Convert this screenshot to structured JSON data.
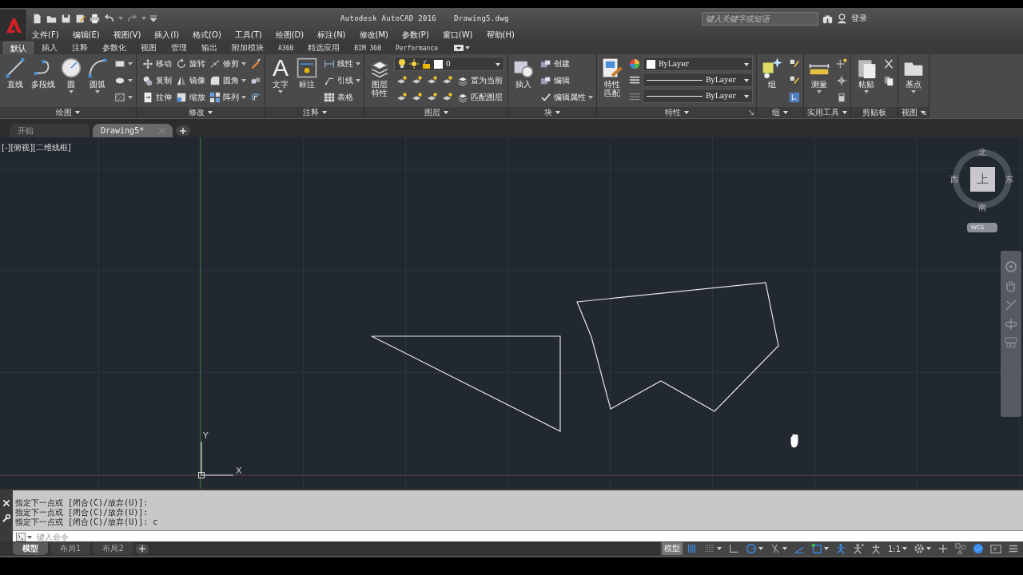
{
  "title_bar": {
    "product": "Autodesk AutoCAD 2016",
    "document": "Drawing5.dwg",
    "search": {
      "placeholder": "键入关键字或短语"
    },
    "sign_in": "登录"
  },
  "menu_bar": [
    "文件(F)",
    "编辑(E)",
    "视图(V)",
    "插入(I)",
    "格式(O)",
    "工具(T)",
    "绘图(D)",
    "标注(N)",
    "修改(M)",
    "参数(P)",
    "窗口(W)",
    "帮助(H)"
  ],
  "ribbon_tabs": [
    {
      "label": "默认",
      "selected": true
    },
    {
      "label": "插入",
      "selected": false
    },
    {
      "label": "注释",
      "selected": false
    },
    {
      "label": "参数化",
      "selected": false
    },
    {
      "label": "视图",
      "selected": false
    },
    {
      "label": "管理",
      "selected": false
    },
    {
      "label": "输出",
      "selected": false
    },
    {
      "label": "附加模块",
      "selected": false
    },
    {
      "label": "A360",
      "selected": false
    },
    {
      "label": "精选应用",
      "selected": false
    },
    {
      "label": "BIM 360",
      "selected": false
    },
    {
      "label": "Performance",
      "selected": false
    }
  ],
  "ribbon_panels": [
    {
      "kind": "inline",
      "title": "绘图",
      "menu": true,
      "launcher": false,
      "large": [
        {
          "kind": "line",
          "label": "直线",
          "dropdown": false
        },
        {
          "kind": "polyline",
          "label": "多段线",
          "dropdown": false
        },
        {
          "kind": "circle",
          "label": "圆",
          "dropdown": true
        },
        {
          "kind": "arc",
          "label": "圆弧",
          "dropdown": true
        }
      ],
      "columns": [
        [
          {
            "kind": "rectangle",
            "dropdown": true
          },
          {
            "kind": "ellipse",
            "dropdown": true
          },
          {
            "kind": "hatch",
            "dropdown": true
          }
        ]
      ]
    },
    {
      "kind": "inline",
      "title": "修改",
      "menu": true,
      "launcher": false,
      "columns": [
        [
          {
            "kind": "cross-arrows",
            "label": "移动",
            "dropdown": false
          },
          {
            "kind": "copy-circles",
            "label": "复制",
            "dropdown": false
          },
          {
            "kind": "stretch-page",
            "label": "拉伸",
            "dropdown": false
          }
        ],
        [
          {
            "kind": "circular-arrow",
            "label": "旋转",
            "dropdown": false
          },
          {
            "kind": "mirror-triangles",
            "label": "镜像",
            "dropdown": false
          },
          {
            "kind": "scale-squares",
            "label": "缩放",
            "dropdown": false
          }
        ],
        [
          {
            "kind": "trim-line",
            "label": "修剪",
            "dropdown": true
          },
          {
            "kind": "rounded-corner",
            "label": "圆角",
            "dropdown": true
          },
          {
            "kind": "grid-squares",
            "label": "阵列",
            "dropdown": true
          }
        ],
        [
          {
            "kind": "eraser",
            "dropdown": false
          },
          {
            "kind": "cubes",
            "dropdown": false
          },
          {
            "kind": "offset-shape",
            "dropdown": false
          }
        ]
      ]
    },
    {
      "kind": "inline",
      "title": "注释",
      "menu": true,
      "launcher": false,
      "large": [
        {
          "kind": "letter",
          "glyph": "A",
          "label": "文字",
          "dropdown": true
        },
        {
          "kind": "dimension",
          "label": "标注",
          "dropdown": false
        }
      ],
      "columns": [
        [
          {
            "kind": "linear-dimension",
            "label": "线性",
            "dropdown": true
          },
          {
            "kind": "leader",
            "label": "引线",
            "dropdown": true
          },
          {
            "kind": "table",
            "label": "表格",
            "dropdown": false
          }
        ]
      ]
    },
    {
      "kind": "stacked",
      "title": "图层",
      "menu": true,
      "launcher": false,
      "large": [
        {
          "kind": "layer-stack",
          "label": "图层特性",
          "dropdown": false
        }
      ],
      "combos": [
        {
          "kind": "layer",
          "value": "0"
        }
      ],
      "columns": [
        [
          {
            "kind": "layer-tool",
            "dropdown": false
          },
          {
            "kind": "layer-tool",
            "dropdown": false
          }
        ],
        [
          {
            "kind": "layer-tool",
            "dropdown": false
          },
          {
            "kind": "layer-tool",
            "dropdown": false
          }
        ],
        [
          {
            "kind": "layer-tool",
            "dropdown": false
          },
          {
            "kind": "layer-tool",
            "dropdown": false
          }
        ],
        [
          {
            "kind": "layer-tool",
            "dropdown": false
          },
          {
            "kind": "layer-tool",
            "dropdown": false
          }
        ],
        [
          {
            "kind": "layer-stack",
            "label": "置为当前",
            "dropdown": false
          },
          {
            "kind": "layer-stack",
            "label": "匹配图层",
            "dropdown": false
          }
        ]
      ]
    },
    {
      "kind": "inline",
      "title": "块",
      "menu": true,
      "launcher": false,
      "large": [
        {
          "kind": "block-insert",
          "label": "插入",
          "dropdown": false
        }
      ],
      "columns": [
        [
          {
            "kind": "block-tool",
            "label": "创建",
            "dropdown": false
          },
          {
            "kind": "block-tool",
            "label": "编辑",
            "dropdown": false
          },
          {
            "kind": "attribute-tick",
            "label": "编辑属性",
            "dropdown": true
          }
        ]
      ]
    },
    {
      "kind": "inline",
      "title": "特性",
      "menu": true,
      "launcher": true,
      "large": [
        {
          "kind": "brush-page",
          "label": "特性匹配",
          "dropdown": false
        }
      ],
      "columns": [
        [
          {
            "kind": "color-wheel",
            "dropdown": false
          },
          {
            "kind": "lineweight-lines",
            "dropdown": false
          },
          {
            "kind": "dashed-lines",
            "dropdown": false
          }
        ]
      ],
      "combos": [
        {
          "kind": "color",
          "value": "ByLayer"
        },
        {
          "kind": "linetype",
          "value": "ByLayer"
        },
        {
          "kind": "lineweight",
          "value": "ByLayer"
        }
      ]
    },
    {
      "kind": "inline",
      "title": "组",
      "menu": true,
      "launcher": false,
      "large": [
        {
          "kind": "sparkle-group",
          "label": "组",
          "dropdown": false
        }
      ],
      "columns": [
        [
          {
            "kind": "group-edit",
            "dropdown": false
          },
          {
            "kind": "group-edit",
            "dropdown": false
          },
          {
            "kind": "group-select",
            "dropdown": false
          }
        ]
      ]
    },
    {
      "kind": "inline",
      "title": "实用工具",
      "menu": true,
      "launcher": false,
      "large": [
        {
          "kind": "ruler",
          "label": "测量",
          "dropdown": true
        }
      ],
      "columns": [
        [
          {
            "kind": "point-add",
            "dropdown": false
          },
          {
            "kind": "crosshair",
            "dropdown": false
          },
          {
            "kind": "calculator",
            "dropdown": false
          }
        ]
      ]
    },
    {
      "kind": "inline",
      "title": "剪贴板",
      "menu": false,
      "launcher": false,
      "large": [
        {
          "kind": "clipboard",
          "label": "粘贴",
          "dropdown": true
        }
      ],
      "columns": [
        [
          {
            "kind": "scissors",
            "dropdown": false
          },
          {
            "kind": "copy-sheets",
            "dropdown": false
          }
        ]
      ]
    },
    {
      "kind": "inline",
      "title": "视图",
      "menu": true,
      "launcher": true,
      "large": [
        {
          "kind": "base-point",
          "label": "基点",
          "dropdown": true
        }
      ]
    }
  ],
  "file_tabs": [
    {
      "label": "开始",
      "selected": false
    },
    {
      "label": "Drawing5*",
      "selected": true
    }
  ],
  "viewport": {
    "view_label": "[-][俯视][二维线框]",
    "viewcube": {
      "north": "北",
      "south": "南",
      "east": "东",
      "west": "西",
      "face": "上",
      "ucs": "WCS"
    },
    "ucs_icon": {
      "x": "X",
      "y": "Y"
    }
  },
  "command_line": {
    "history": [
      "指定下一点或 [闭合(C)/放弃(U)]:",
      "指定下一点或 [闭合(C)/放弃(U)]:",
      "指定下一点或 [闭合(C)/放弃(U)]: c"
    ],
    "input": {
      "placeholder": "键入命令"
    }
  },
  "layout_tabs": [
    {
      "label": "模型",
      "selected": true
    },
    {
      "label": "布局1",
      "selected": false
    },
    {
      "label": "布局2",
      "selected": false
    }
  ],
  "status_bar": [
    {
      "kind": "label",
      "text": "模型",
      "on": true,
      "dropdown": false
    },
    {
      "kind": "grid-lines",
      "on": true,
      "dropdown": false
    },
    {
      "kind": "dot-grid",
      "on": false,
      "dropdown": true
    },
    {
      "kind": "ortho-corner",
      "on": false,
      "dropdown": false
    },
    {
      "kind": "polar-circle",
      "on": true,
      "dropdown": true
    },
    {
      "kind": "slash-lines",
      "on": false,
      "dropdown": true
    },
    {
      "kind": "angle",
      "on": true,
      "dropdown": false
    },
    {
      "kind": "snap-square",
      "on": true,
      "dropdown": true
    },
    {
      "kind": "figure",
      "on": true,
      "dropdown": false
    },
    {
      "kind": "figure-star",
      "on": false,
      "dropdown": false
    },
    {
      "kind": "figure-plain",
      "on": false,
      "dropdown": false
    },
    {
      "kind": "label",
      "text": "1:1",
      "on": false,
      "dropdown": true
    },
    {
      "kind": "gear",
      "on": false,
      "dropdown": true
    },
    {
      "kind": "plus",
      "on": false,
      "dropdown": false
    },
    {
      "kind": "shapes",
      "on": false,
      "dropdown": false
    },
    {
      "kind": "filled-circle",
      "on": true,
      "dropdown": false
    },
    {
      "kind": "window",
      "on": false,
      "dropdown": false
    },
    {
      "kind": "hamburger",
      "on": false,
      "dropdown": false
    }
  ]
}
